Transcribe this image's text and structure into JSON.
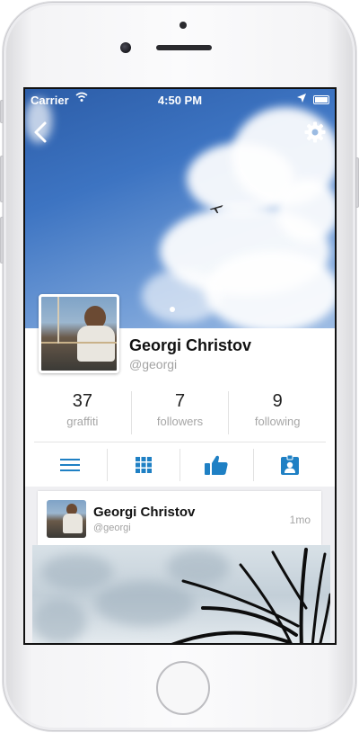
{
  "status_bar": {
    "carrier": "Carrier",
    "time": "4:50 PM"
  },
  "icons": {
    "back": "chevron-left-icon",
    "settings": "gear-icon",
    "tab_list": "list-icon",
    "tab_grid": "grid-icon",
    "tab_likes": "thumbs-up-icon",
    "tab_profile": "contact-badge-icon"
  },
  "profile": {
    "name": "Georgi Christov",
    "handle": "@georgi"
  },
  "stats": [
    {
      "value": "37",
      "label": "graffiti"
    },
    {
      "value": "7",
      "label": "followers"
    },
    {
      "value": "9",
      "label": "following"
    }
  ],
  "post": {
    "author_name": "Georgi Christov",
    "author_handle": "@georgi",
    "time": "1mo"
  },
  "colors": {
    "accent": "#1f80c4",
    "secondary_text": "#a6a6a6"
  }
}
